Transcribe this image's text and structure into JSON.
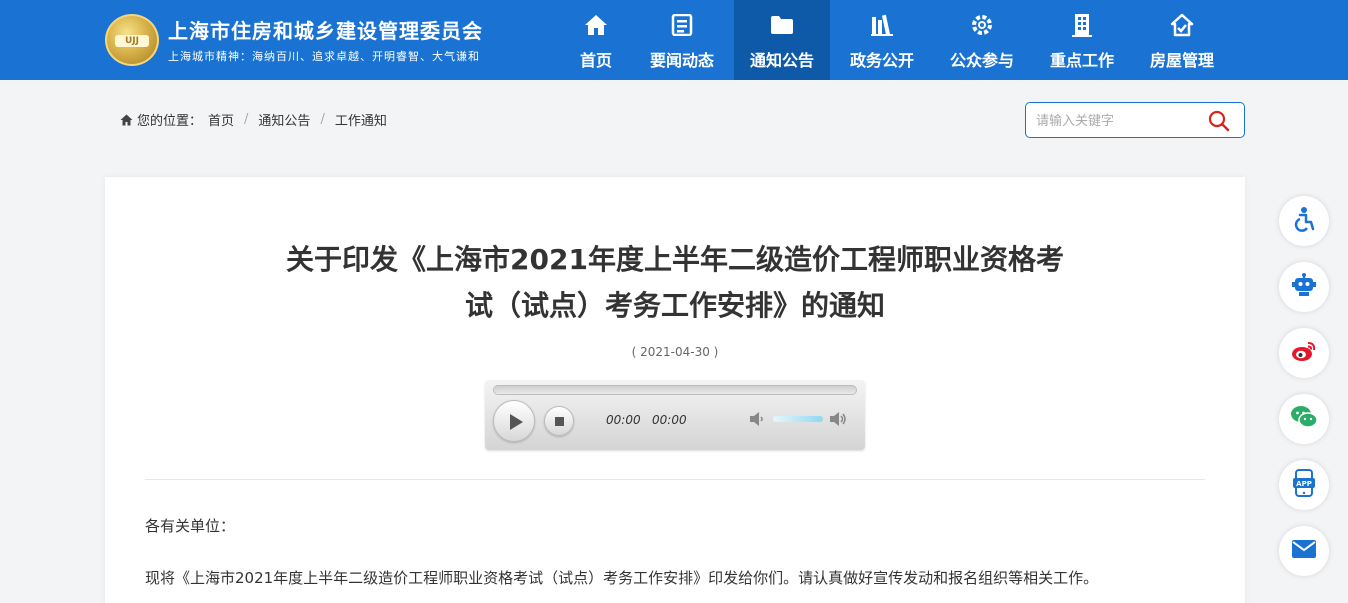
{
  "header": {
    "logo_text": "UJJ",
    "title": "上海市住房和城乡建设管理委员会",
    "subtitle": "上海城市精神：海纳百川、追求卓越、开明睿智、大气谦和"
  },
  "nav": [
    {
      "label": "首页",
      "icon": "home-icon"
    },
    {
      "label": "要闻动态",
      "icon": "news-icon"
    },
    {
      "label": "通知公告",
      "icon": "folder-icon",
      "active": true
    },
    {
      "label": "政务公开",
      "icon": "books-icon"
    },
    {
      "label": "公众参与",
      "icon": "gear-people-icon"
    },
    {
      "label": "重点工作",
      "icon": "building-icon"
    },
    {
      "label": "房屋管理",
      "icon": "house-check-icon"
    }
  ],
  "breadcrumb": {
    "prefix": "您的位置：",
    "items": [
      "首页",
      "通知公告",
      "工作通知"
    ],
    "separator": "/"
  },
  "search": {
    "placeholder": "请输入关键字",
    "value": ""
  },
  "article": {
    "title_line1": "关于印发《上海市2021年度上半年二级造价工程师职业资格考",
    "title_line2": "试（试点）考务工作安排》的通知",
    "date": "( 2021-04-30 )",
    "greeting": "各有关单位：",
    "body": "现将《上海市2021年度上半年二级造价工程师职业资格考试（试点）考务工作安排》印发给你们。请认真做好宣传发动和报名组织等相关工作。"
  },
  "player": {
    "current_time": "00:00",
    "duration": "00:00",
    "progress": 0,
    "volume": 1.0
  },
  "side_toolbar": [
    "accessibility-icon",
    "robot-icon",
    "weibo-icon",
    "wechat-icon",
    "app-icon",
    "mail-icon"
  ],
  "colors": {
    "brand_blue": "#1a73d2",
    "nav_active": "#0f5aa8",
    "search_red": "#d9241c",
    "side_blue": "#1a73d2"
  }
}
